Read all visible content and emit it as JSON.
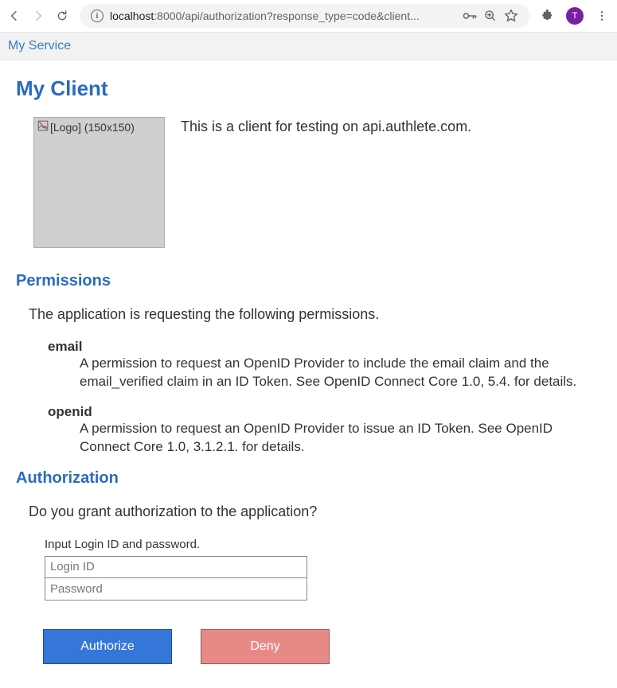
{
  "browser": {
    "url_host": "localhost",
    "url_rest": ":8000/api/authorization?response_type=code&client...",
    "avatar_letter": "T"
  },
  "service": {
    "name": "My Service"
  },
  "client": {
    "title": "My Client",
    "logo_alt": "[Logo] (150x150)",
    "description": "This is a client for testing on api.authlete.com."
  },
  "permissions": {
    "heading": "Permissions",
    "intro": "The application is requesting the following permissions.",
    "items": [
      {
        "name": "email",
        "desc": "A permission to request an OpenID Provider to include the email claim and the email_verified claim in an ID Token. See OpenID Connect Core 1.0, 5.4. for details."
      },
      {
        "name": "openid",
        "desc": "A permission to request an OpenID Provider to issue an ID Token. See OpenID Connect Core 1.0, 3.1.2.1. for details."
      }
    ]
  },
  "authorization": {
    "heading": "Authorization",
    "question": "Do you grant authorization to the application?",
    "login_label": "Input Login ID and password.",
    "login_id_placeholder": "Login ID",
    "password_placeholder": "Password",
    "authorize_label": "Authorize",
    "deny_label": "Deny"
  }
}
